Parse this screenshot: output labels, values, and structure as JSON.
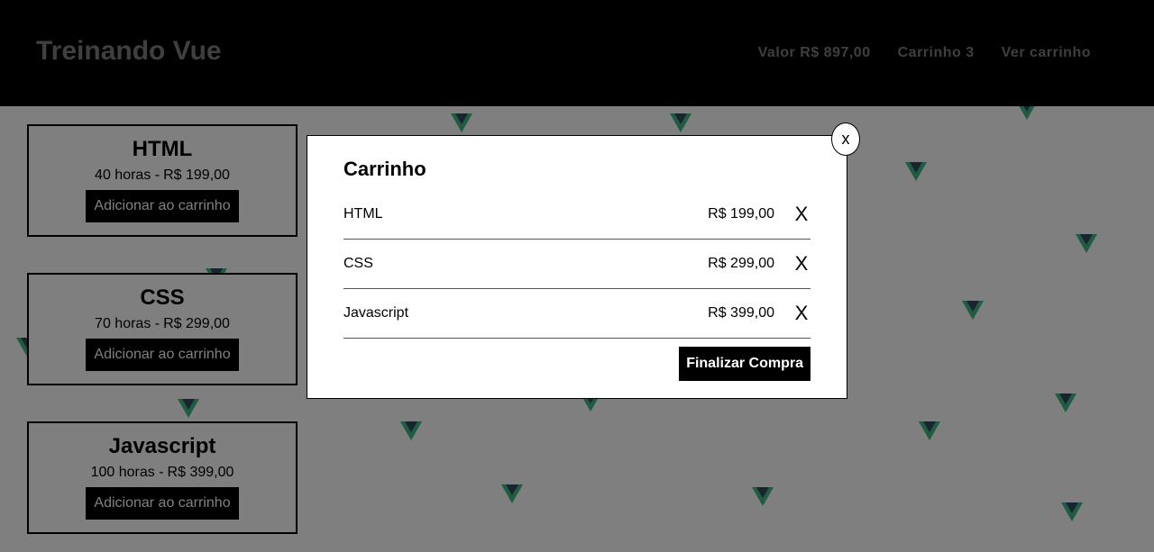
{
  "header": {
    "brand": "Treinando Vue",
    "nav": {
      "value_prefix": "Valor",
      "value_amount": "R$ 897,00",
      "cart_label": "Carrinho 3",
      "view_cart": "Ver carrinho"
    }
  },
  "products": [
    {
      "title": "HTML",
      "hours": "40 horas -",
      "price": "R$ 199,00",
      "button": "Adicionar ao carrinho"
    },
    {
      "title": "CSS",
      "hours": "70 horas -",
      "price": "R$ 299,00",
      "button": "Adicionar ao carrinho"
    },
    {
      "title": "Javascript",
      "hours": "100 horas -",
      "price": "R$ 399,00",
      "button": "Adicionar ao carrinho"
    }
  ],
  "modal": {
    "close": "x",
    "title": "Carrinho",
    "items": [
      {
        "name": "HTML",
        "price": "R$ 199,00",
        "remove": "X"
      },
      {
        "name": "CSS",
        "price": "R$ 299,00",
        "remove": "X"
      },
      {
        "name": "Javascript",
        "price": "R$ 399,00",
        "remove": "X"
      }
    ],
    "finish": "Finalizar Compra"
  },
  "colors": {
    "overlay": "rgba(0,0,0,0.5)",
    "logo_green": "#41b883",
    "logo_dark": "#35495e"
  },
  "icons": {
    "background_logo": "vue-logo-icon"
  }
}
